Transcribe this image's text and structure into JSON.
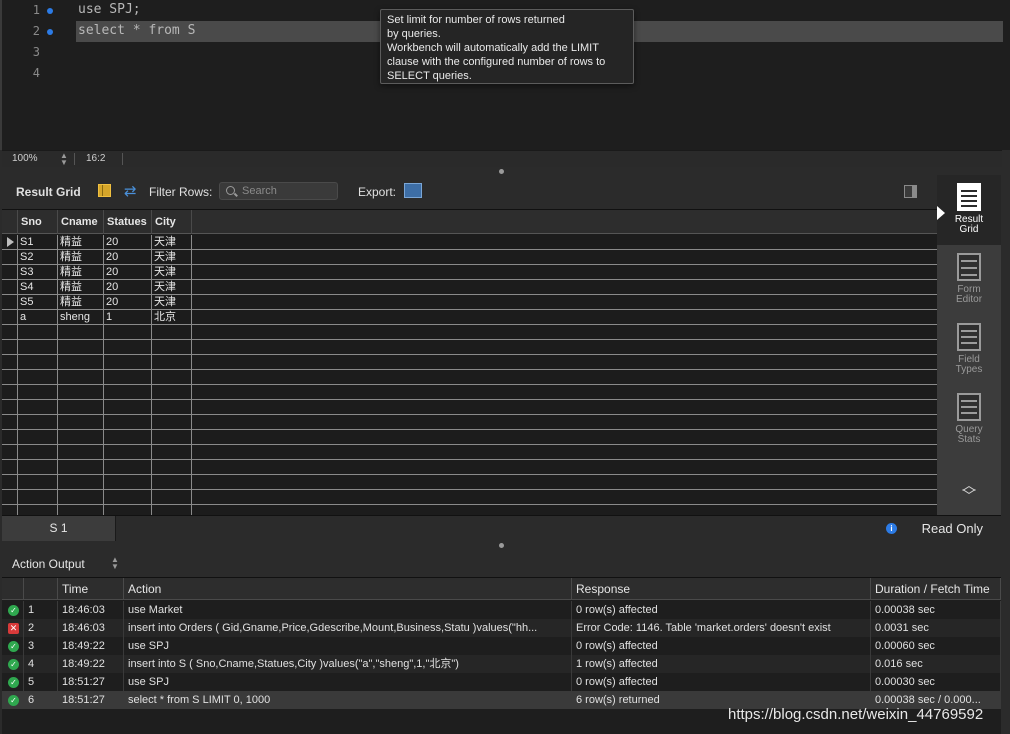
{
  "editor": {
    "lines": [
      {
        "num": "1",
        "code": "use SPJ;",
        "marker": true,
        "active": false
      },
      {
        "num": "2",
        "code": "select * from S",
        "marker": true,
        "active": true
      },
      {
        "num": "3",
        "code": "",
        "marker": false,
        "active": false
      },
      {
        "num": "4",
        "code": "",
        "marker": false,
        "active": false
      }
    ],
    "tooltip": [
      "Set limit for number of rows returned",
      "by queries.",
      "Workbench will automatically add the LIMIT",
      "clause with the configured number of rows to",
      "SELECT queries."
    ],
    "zoom": "100%",
    "cursor_position": "16:2"
  },
  "result_toolbar": {
    "title": "Result Grid",
    "filter_label": "Filter Rows:",
    "search_placeholder": "Search",
    "export_label": "Export:"
  },
  "grid": {
    "columns": [
      "Sno",
      "Cname",
      "Statues",
      "City"
    ],
    "rows": [
      [
        "S1",
        "精益",
        "20",
        "天津"
      ],
      [
        "S2",
        "精益",
        "20",
        "天津"
      ],
      [
        "S3",
        "精益",
        "20",
        "天津"
      ],
      [
        "S4",
        "精益",
        "20",
        "天津"
      ],
      [
        "S5",
        "精益",
        "20",
        "天津"
      ],
      [
        "a",
        "sheng",
        "1",
        "北京"
      ]
    ],
    "empty_rows": 13
  },
  "side_panel": {
    "items": [
      {
        "label1": "Result",
        "label2": "Grid",
        "active": true
      },
      {
        "label1": "Form",
        "label2": "Editor",
        "active": false
      },
      {
        "label1": "Field",
        "label2": "Types",
        "active": false
      },
      {
        "label1": "Query",
        "label2": "Stats",
        "active": false
      }
    ]
  },
  "result_tabs": {
    "tab": "S 1",
    "read_only": "Read Only"
  },
  "output": {
    "title": "Action Output",
    "columns": [
      "",
      "Time",
      "Action",
      "Response",
      "Duration / Fetch Time"
    ],
    "rows": [
      {
        "status": "ok",
        "num": "1",
        "time": "18:46:03",
        "action": "use Market",
        "response": "0 row(s) affected",
        "duration": "0.00038 sec"
      },
      {
        "status": "error",
        "num": "2",
        "time": "18:46:03",
        "action": "insert into Orders (  Gid,Gname,Price,Gdescribe,Mount,Business,Statu )values(\"hh...",
        "response": "Error Code: 1146. Table 'market.orders' doesn't exist",
        "duration": "0.0031 sec"
      },
      {
        "status": "ok",
        "num": "3",
        "time": "18:49:22",
        "action": "use SPJ",
        "response": "0 row(s) affected",
        "duration": "0.00060 sec"
      },
      {
        "status": "ok",
        "num": "4",
        "time": "18:49:22",
        "action": "insert into S (  Sno,Cname,Statues,City )values(\"a\",\"sheng\",1,\"北京\")",
        "response": "1 row(s) affected",
        "duration": "0.016 sec"
      },
      {
        "status": "ok",
        "num": "5",
        "time": "18:51:27",
        "action": "use SPJ",
        "response": "0 row(s) affected",
        "duration": "0.00030 sec"
      },
      {
        "status": "ok",
        "num": "6",
        "time": "18:51:27",
        "action": "select * from S LIMIT 0, 1000",
        "response": "6 row(s) returned",
        "duration": "0.00038 sec / 0.000..."
      }
    ]
  },
  "watermark": "https://blog.csdn.net/weixin_44769592",
  "colors": {
    "accent_blue": "#2c7be5",
    "ok_green": "#2fa84f",
    "error_red": "#d83a3a"
  }
}
